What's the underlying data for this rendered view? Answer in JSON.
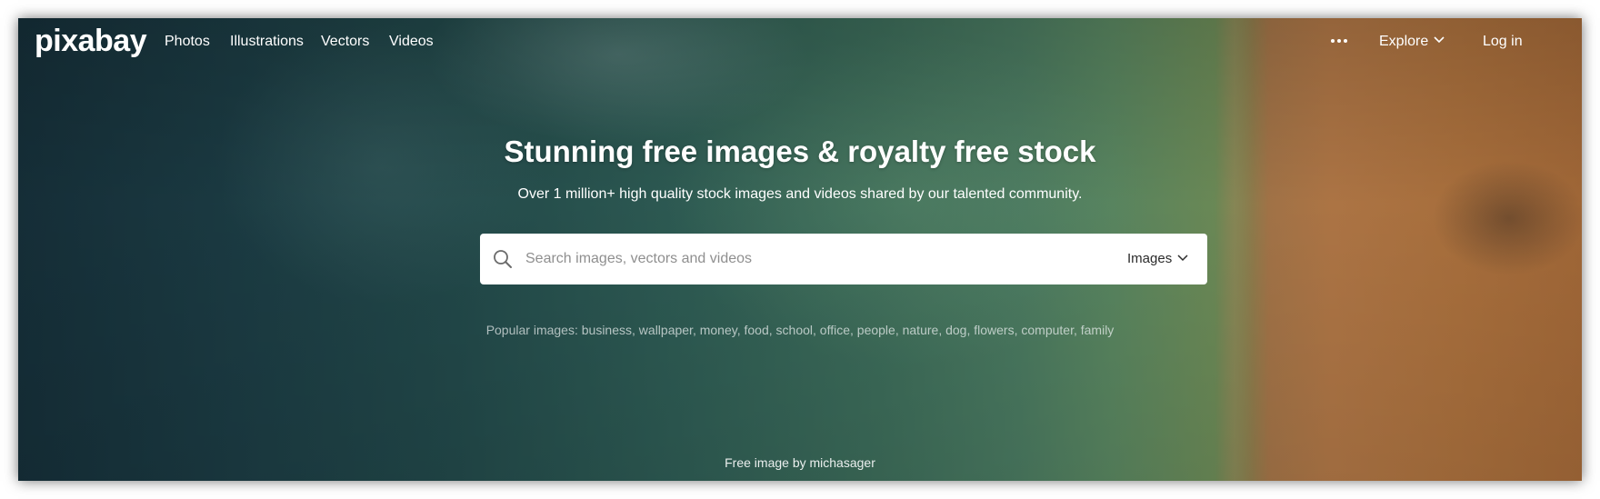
{
  "brand": {
    "logo_text": "pixabay"
  },
  "nav": {
    "links": [
      "Photos",
      "Illustrations",
      "Vectors",
      "Videos"
    ],
    "more_icon": "ellipsis-icon",
    "explore_label": "Explore",
    "login_label": "Log in"
  },
  "hero": {
    "title": "Stunning free images & royalty free stock",
    "subtitle": "Over 1 million+ high quality stock images and videos shared by our talented community."
  },
  "search": {
    "icon": "search-icon",
    "placeholder": "Search images, vectors and videos",
    "value": "",
    "type_selected": "Images"
  },
  "popular": {
    "prefix": "Popular images:",
    "tags": [
      "business",
      "wallpaper",
      "money",
      "food",
      "school",
      "office",
      "people",
      "nature",
      "dog",
      "flowers",
      "computer",
      "family"
    ]
  },
  "credit": {
    "prefix": "Free image by",
    "user": "michasager"
  },
  "colors": {
    "water_dark": "#16303a",
    "water_green": "#4c7d63",
    "sand": "#b57a48",
    "text": "#ffffff"
  }
}
